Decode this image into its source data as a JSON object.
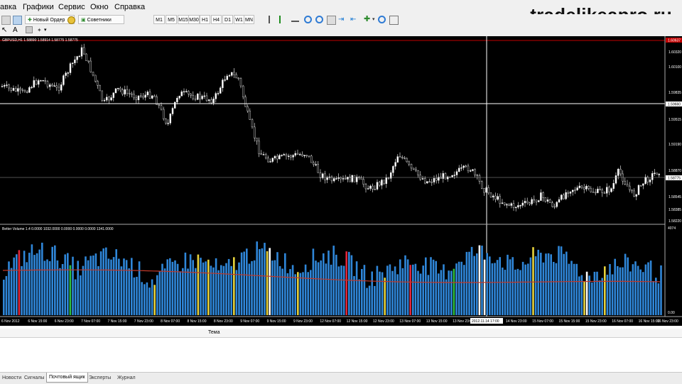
{
  "menu": [
    "авка",
    "Графики",
    "Сервис",
    "Окно",
    "Справка"
  ],
  "watermark": "tradelikeapro.ru",
  "toolbar": {
    "new_order": "Новый Ордер",
    "advisors": "Советники",
    "timeframes": [
      "M1",
      "M5",
      "M15",
      "M30",
      "H1",
      "H4",
      "D1",
      "W1",
      "MN"
    ]
  },
  "chart": {
    "symbol_header": "GBPUSD,H1  1.58890 1.58914 1.58775 1.58775",
    "indicator_header": "Better Volume 1.4  0.0000 1032.0000 0.0000 0.0000 0.0000 1341.0000",
    "price_labels": [
      "1.60320",
      "1.60100",
      "1.59835",
      "1.59660",
      "1.59515",
      "1.59190",
      "1.58870",
      "1.58775",
      "1.58545",
      "1.58385",
      "1.58220"
    ],
    "current_price": "1.58775",
    "crosshair_price": "1.59660",
    "top_price": "1.60637",
    "volume_labels": [
      "4074",
      "0.00"
    ],
    "time_labels": [
      "6 Nov 2012",
      "6 Nov 15:00",
      "6 Nov 23:00",
      "7 Nov 07:00",
      "7 Nov 15:00",
      "7 Nov 23:00",
      "8 Nov 07:00",
      "8 Nov 15:00",
      "8 Nov 23:00",
      "9 Nov 07:00",
      "9 Nov 15:00",
      "9 Nov 23:00",
      "12 Nov 07:00",
      "12 Nov 15:00",
      "12 Nov 23:00",
      "13 Nov 07:00",
      "13 Nov 15:00",
      "13 Nov 23:00",
      "2012.11.14 17:00",
      "14 Nov 23:00",
      "15 Nov 07:00",
      "15 Nov 15:00",
      "15 Nov 23:00",
      "16 Nov 07:00",
      "16 Nov 15:00",
      "16 Nov 23:00"
    ],
    "crosshair_time": "2012.11.14 17:00",
    "colors": {
      "background": "#000000",
      "candle": "#ffffff",
      "volume_blue": "#2f86d8",
      "volume_red": "#e0263a",
      "volume_yellow": "#e6d23c",
      "volume_green": "#2fbf3f",
      "volume_white": "#ffffff",
      "volume_ma": "#c0392b",
      "level_line": "#c00000"
    }
  },
  "bottom": {
    "column_header": "Тема",
    "tabs": [
      "Новости",
      "Сигналы",
      "Почтовый ящик",
      "Эксперты",
      "Журнал"
    ],
    "active_tab": 2
  }
}
